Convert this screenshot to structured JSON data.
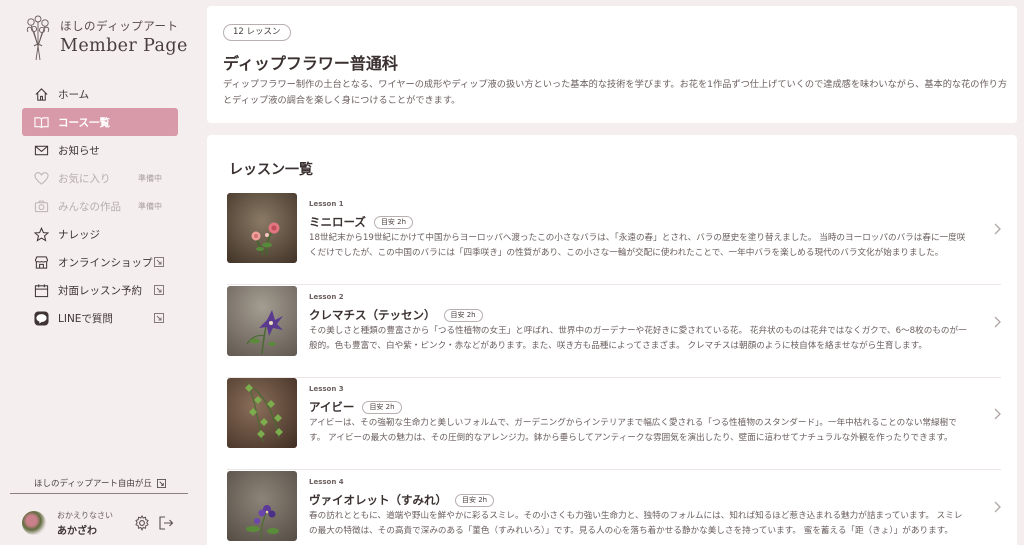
{
  "brand": {
    "subtitle": "ほしのディップアート",
    "title": "Member Page"
  },
  "nav": [
    {
      "label": "ホーム",
      "icon": "home-icon"
    },
    {
      "label": "コース一覧",
      "icon": "book-icon",
      "active": true
    },
    {
      "label": "お知らせ",
      "icon": "mail-icon"
    },
    {
      "label": "お気に入り",
      "icon": "heart-icon",
      "soon": "準備中"
    },
    {
      "label": "みんなの作品",
      "icon": "camera-icon",
      "soon": "準備中"
    },
    {
      "label": "ナレッジ",
      "icon": "star-icon"
    },
    {
      "label": "オンラインショップ",
      "icon": "shop-icon",
      "external": true
    },
    {
      "label": "対面レッスン予約",
      "icon": "calendar-icon",
      "external": true
    },
    {
      "label": "LINEで質問",
      "icon": "line-icon",
      "external": true
    }
  ],
  "community": "ほしのディップアート自由が丘",
  "user": {
    "greeting": "おかえりなさい",
    "name": "あかざわ"
  },
  "course": {
    "badge": "12 レッスン",
    "title": "ディップフラワー普通科",
    "description": "ディップフラワー制作の土台となる、ワイヤーの成形やディップ液の扱い方といった基本的な技術を学びます。お花を1作品ずつ仕上げていくので達成感を味わいながら、基本的な花の作り方とディップ液の調合を楽しく身につけることができます。"
  },
  "lessons_title": "レッスン一覧",
  "lessons": [
    {
      "number": "Lesson 1",
      "name": "ミニローズ",
      "duration": "目安 2h",
      "text": "18世紀末から19世紀にかけて中国からヨーロッパへ渡ったこの小さなバラは、「永遠の春」とされ、バラの歴史を塗り替えました。 当時のヨーロッパのバラは春に一度咲くだけでしたが、この中国のバラには「四季咲き」の性質があり、この小さな一輪が交配に使われたことで、一年中バラを楽しめる現代のバラ文化が始まりました。"
    },
    {
      "number": "Lesson 2",
      "name": "クレマチス（テッセン）",
      "duration": "目安 2h",
      "text": "その美しさと種類の豊富さから「つる性植物の女王」と呼ばれ、世界中のガーデナーや花好きに愛されている花。 花弁状のものは花弁ではなくガクで、6〜8枚のものが一般的。色も豊富で、白や紫・ピンク・赤などがあります。また、咲き方も品種によってさまざま。 クレマチスは朝顔のように枝自体を絡ませながら生育します。"
    },
    {
      "number": "Lesson 3",
      "name": "アイビー",
      "duration": "目安 2h",
      "text": "アイビーは、その強靭な生命力と美しいフォルムで、ガーデニングからインテリアまで幅広く愛される「つる性植物のスタンダード」。一年中枯れることのない常緑樹です。 アイビーの最大の魅力は、その圧倒的なアレンジ力。鉢から垂らしてアンティークな雰囲気を演出したり、壁面に這わせてナチュラルな外観を作ったりできます。"
    },
    {
      "number": "Lesson 4",
      "name": "ヴァイオレット（すみれ）",
      "duration": "目安 2h",
      "text": "春の訪れとともに、道端や野山を鮮やかに彩るスミレ。その小さくも力強い生命力と、独特のフォルムには、知れば知るほど惹き込まれる魅力が詰まっています。 スミレの最大の特徴は、その高貴で深みのある「菫色（すみれいろ）」です。見る人の心を落ち着かせる静かな美しさを持っています。 蜜を蓄える「距（きょ）」があります。"
    }
  ]
}
